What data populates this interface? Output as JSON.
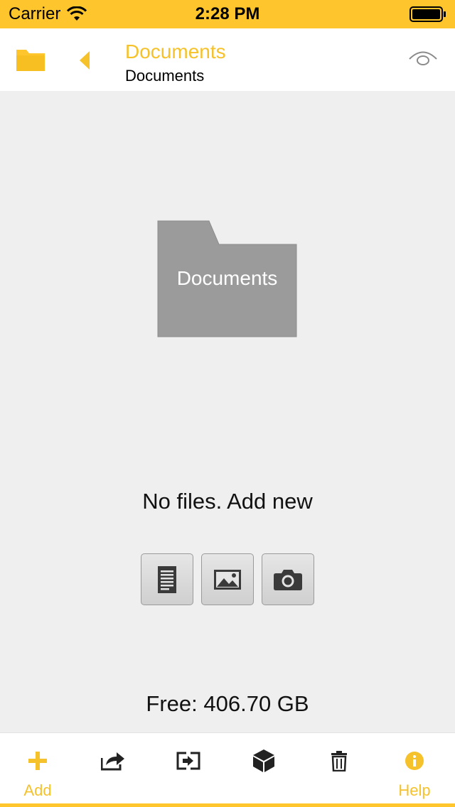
{
  "status_bar": {
    "carrier": "Carrier",
    "time": "2:28 PM"
  },
  "header": {
    "title": "Documents",
    "subtitle": "Documents"
  },
  "main": {
    "folder_label": "Documents",
    "empty_message": "No files. Add new",
    "free_space": "Free: 406.70 GB",
    "add_buttons": [
      "document-icon",
      "image-icon",
      "camera-icon"
    ]
  },
  "toolbar": {
    "items": [
      {
        "icon": "plus-icon",
        "label": "Add"
      },
      {
        "icon": "share-icon",
        "label": ""
      },
      {
        "icon": "move-icon",
        "label": ""
      },
      {
        "icon": "archive-box-icon",
        "label": ""
      },
      {
        "icon": "trash-icon",
        "label": ""
      },
      {
        "icon": "info-icon",
        "label": "Help"
      }
    ]
  },
  "colors": {
    "accent": "#ffc52d",
    "accent_text": "#f5c22c",
    "background": "#efefef",
    "folder_gray": "#9b9b9b"
  }
}
